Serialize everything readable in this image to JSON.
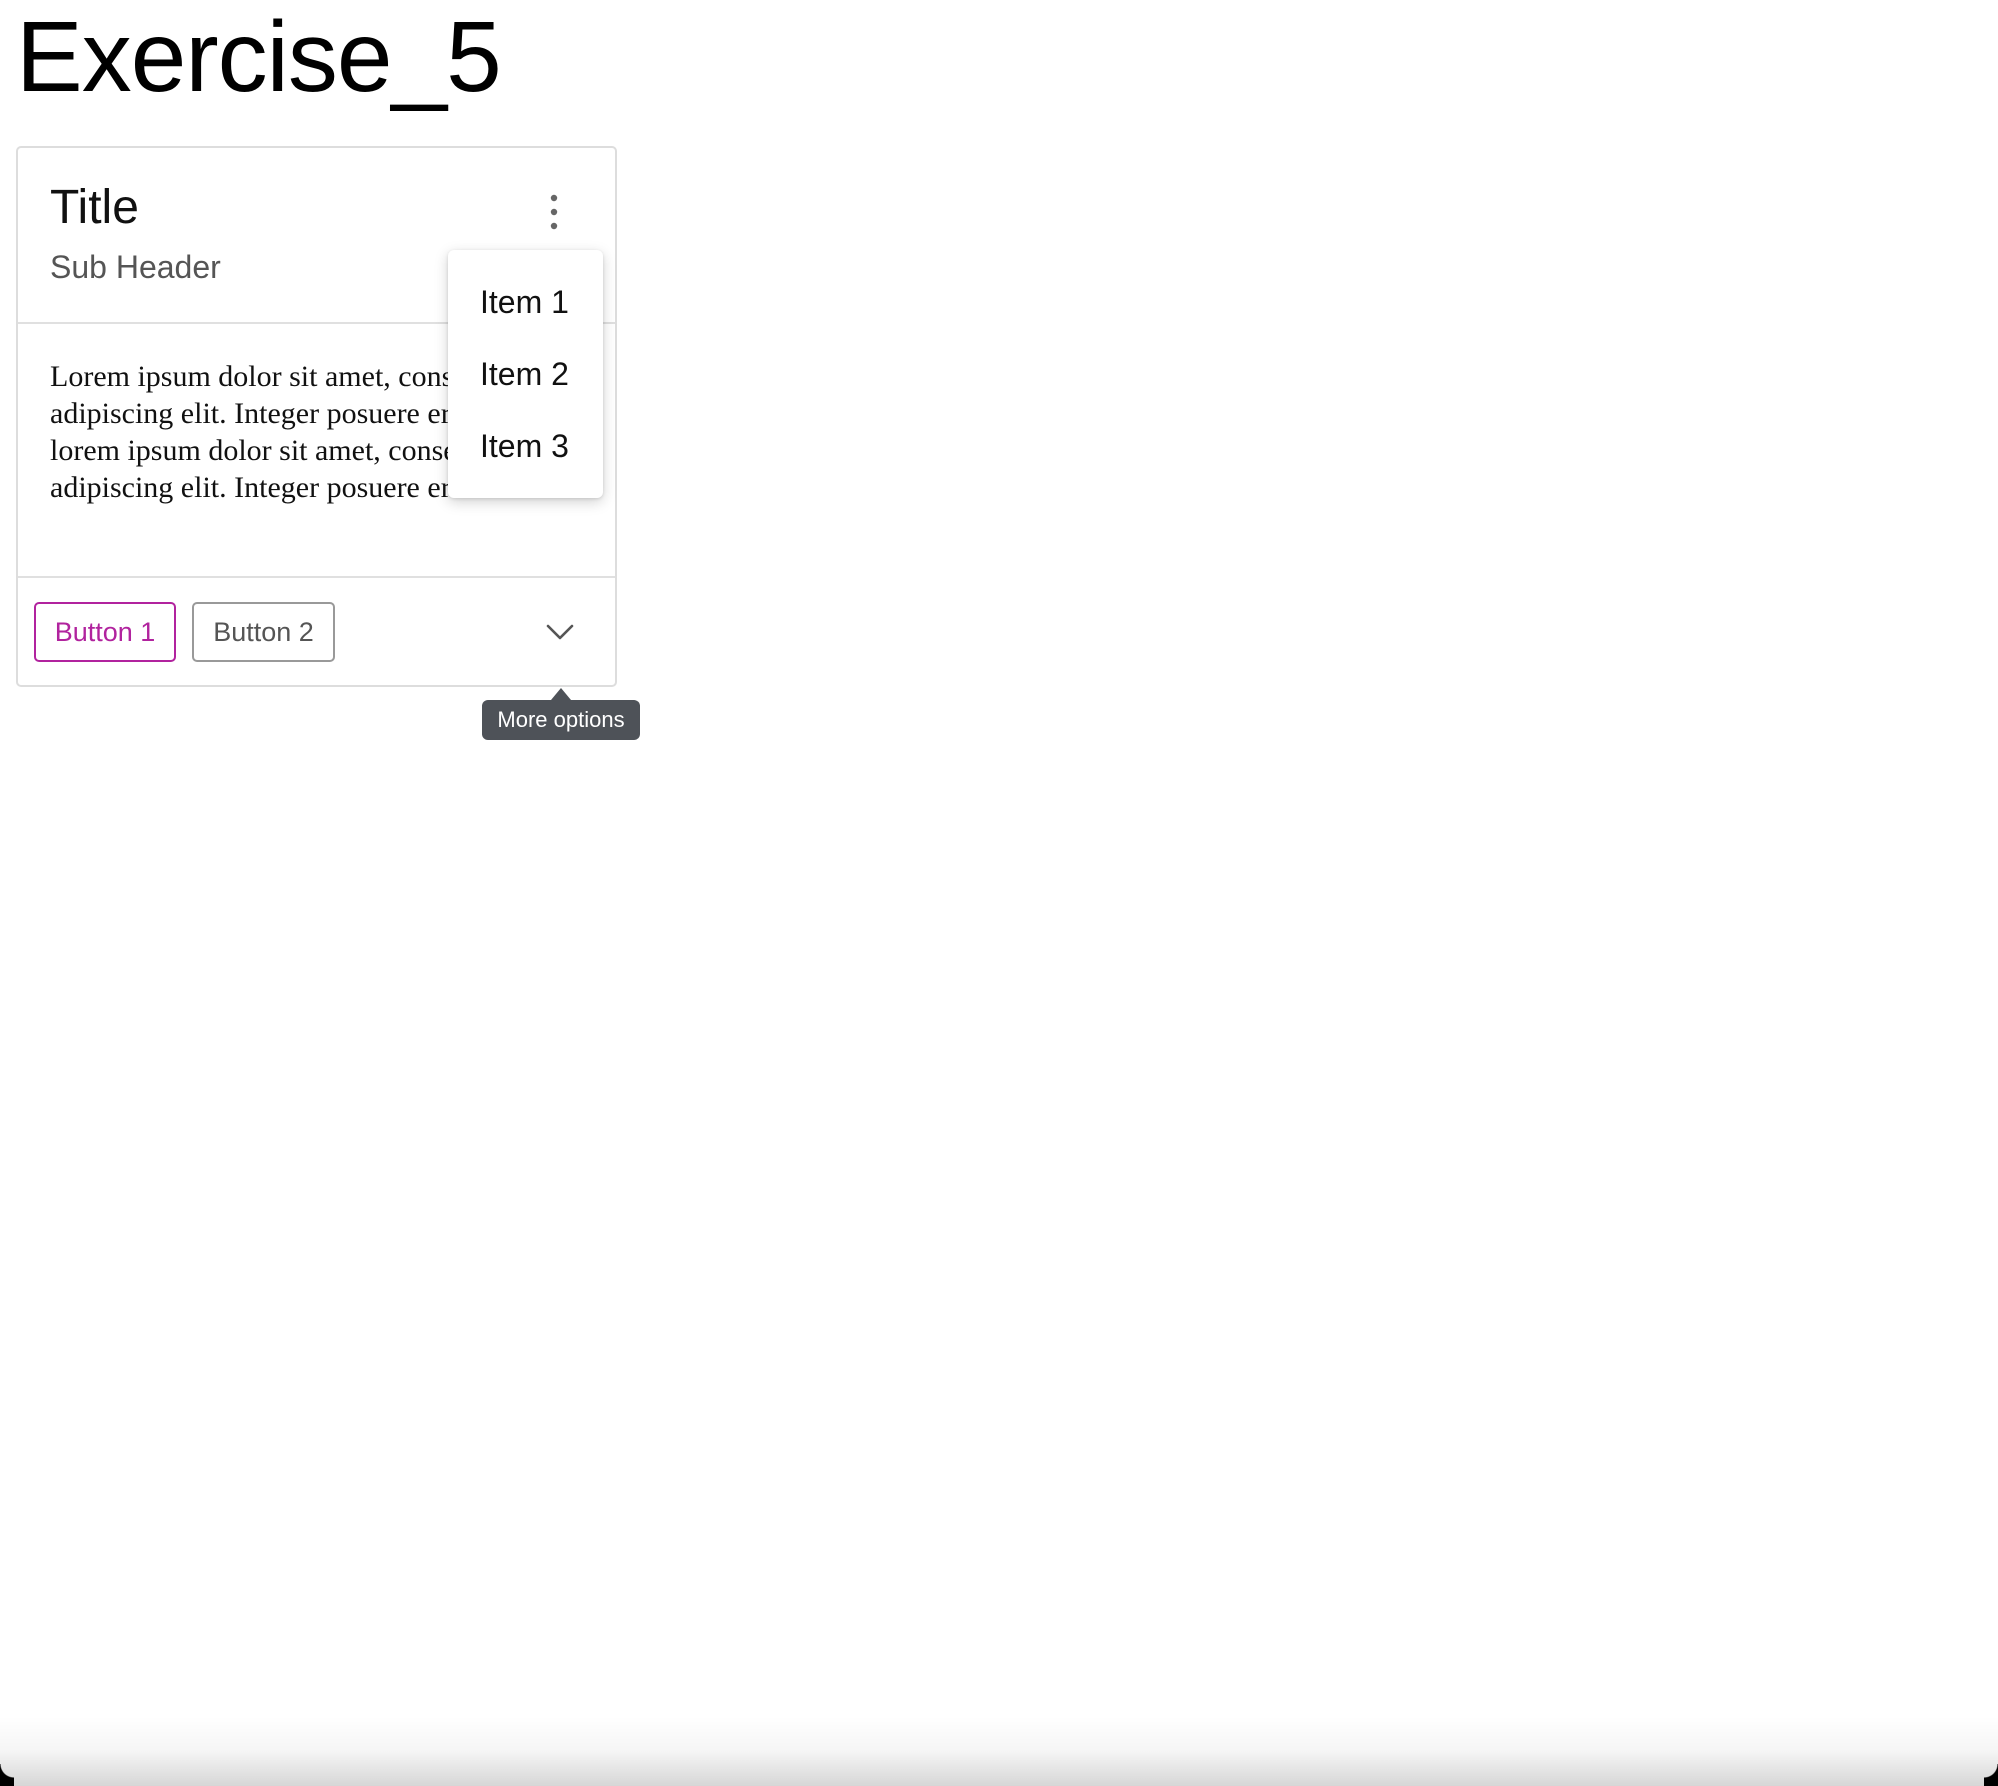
{
  "page": {
    "title": "Exercise_5"
  },
  "card": {
    "title": "Title",
    "subheader": "Sub Header",
    "body": "Lorem ipsum dolor sit amet, consectetur adipiscing elit. Integer posuere erat a ante. lorem ipsum dolor sit amet, consectetur adipiscing elit. Integer posuere erat a ante.",
    "more_icon": "more-vert-icon",
    "buttons": {
      "button1": "Button 1",
      "button2": "Button 2"
    },
    "expand_icon": "chevron-down-icon"
  },
  "menu": {
    "items": [
      {
        "label": "Item 1"
      },
      {
        "label": "Item 2"
      },
      {
        "label": "Item 3"
      }
    ]
  },
  "tooltip": {
    "text": "More options"
  },
  "colors": {
    "accent": "#b1239e",
    "tooltip_bg": "#4e5258",
    "border": "#dddddd"
  }
}
